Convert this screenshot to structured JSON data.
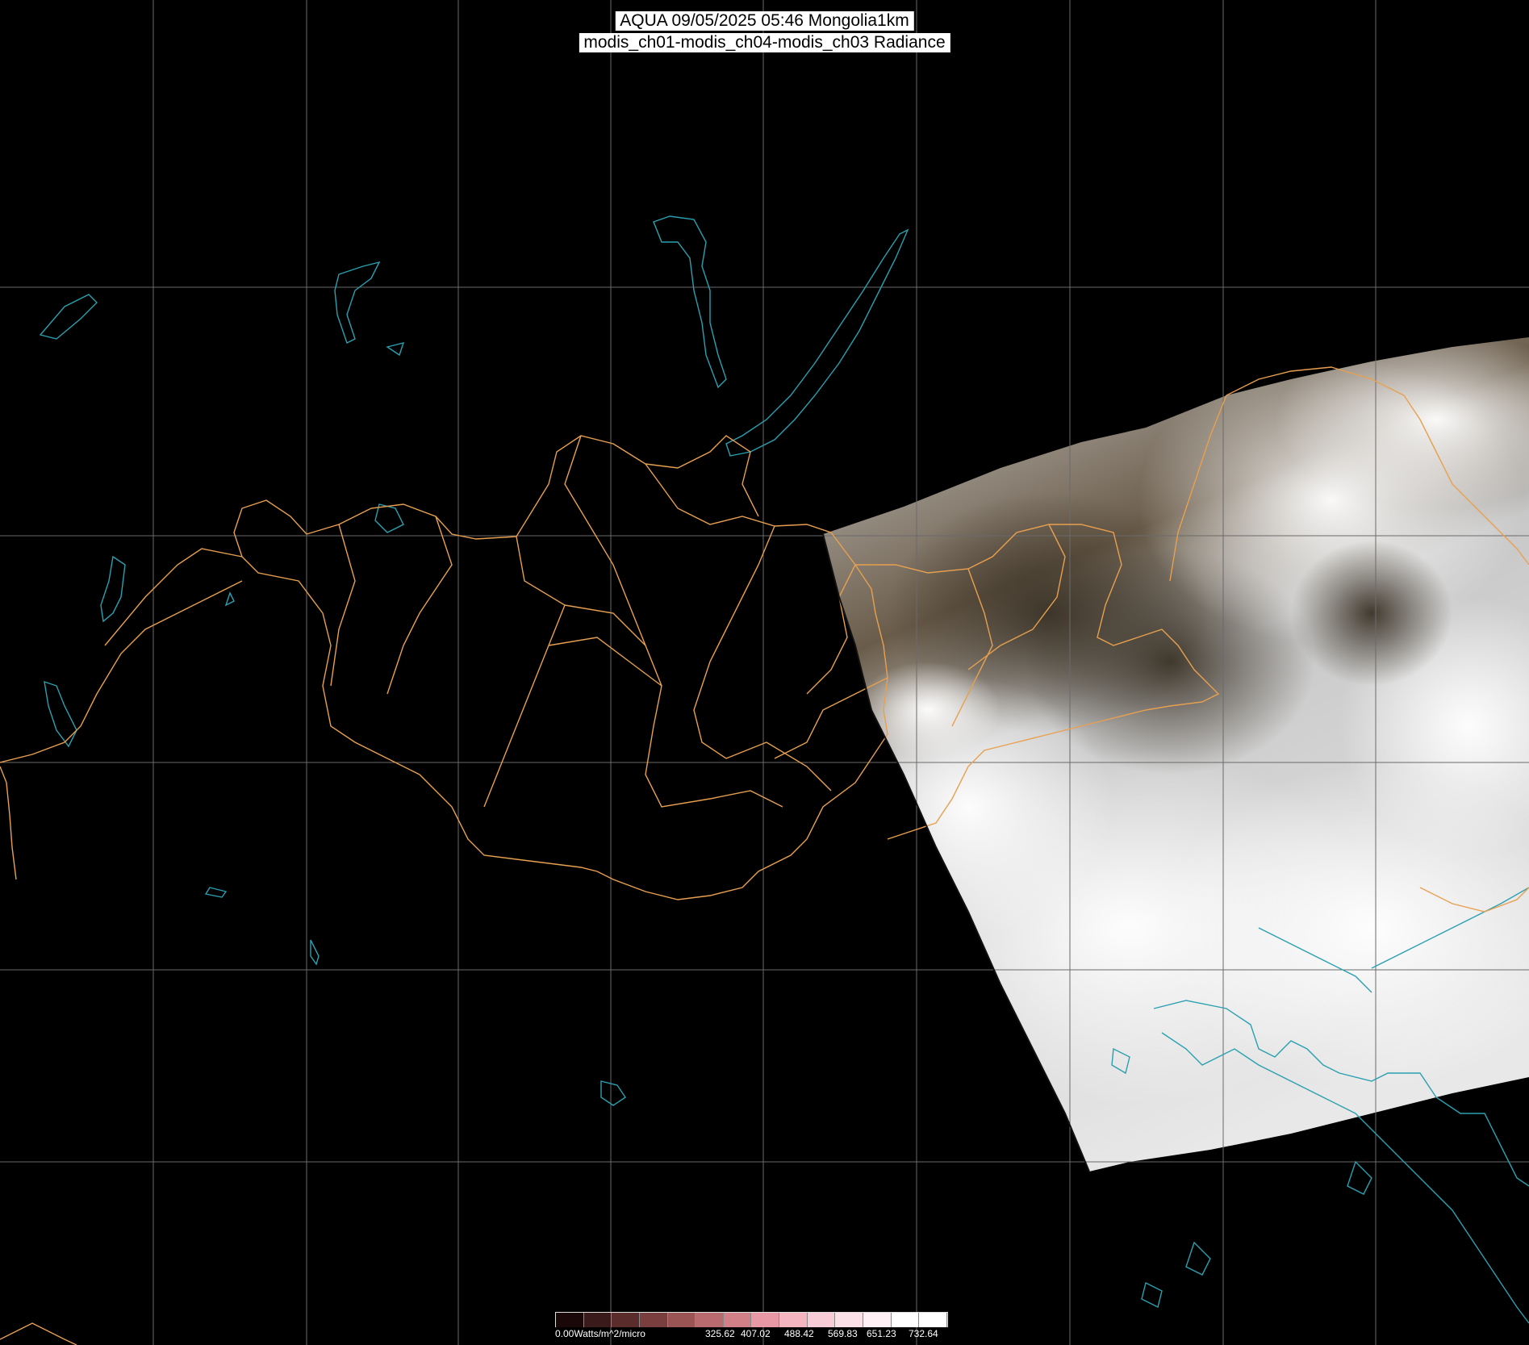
{
  "title": {
    "line1": "AQUA 09/05/2025 05:46 Mongolia1km",
    "line2": "modis_ch01-modis_ch04-modis_ch03 Radiance"
  },
  "map": {
    "background_color": "#000000",
    "graticule_color": "#6a6a6a",
    "coastline_color": "#2aa0b0",
    "border_color": "#e8a050",
    "swath": "true-color satellite swath with cloud cover over eastern Mongolia and northern China"
  },
  "legend": {
    "unit_label": "0.00Watts/m^2/micro",
    "ticks": [
      "325.62",
      "407.02",
      "488.42",
      "569.83",
      "651.23",
      "732.64"
    ],
    "colors": [
      "#1a0808",
      "#3a1a1a",
      "#5a2c2c",
      "#7a3e3e",
      "#9a5454",
      "#b86a6e",
      "#d28088",
      "#e898a4",
      "#f4b4c0",
      "#f8ccd6",
      "#fce0e8",
      "#fef0f4",
      "#ffffff",
      "#ffffff"
    ]
  }
}
